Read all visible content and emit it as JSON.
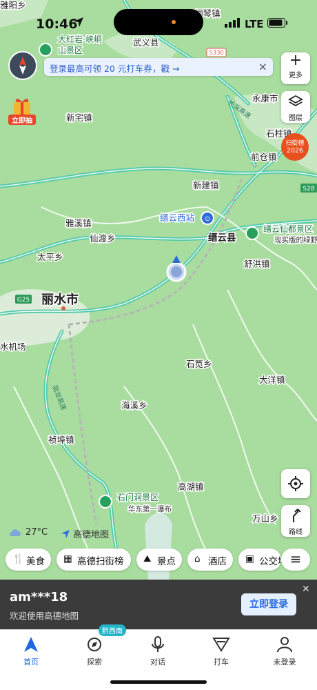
{
  "status_bar": {
    "time": "10:46",
    "network": "LTE"
  },
  "promo_banner": {
    "text": "登录最高可领 20 元打车券，戳 →"
  },
  "side_buttons": {
    "more": "更多",
    "layers": "图层",
    "route": "路线"
  },
  "gift": {
    "label": "立即抽"
  },
  "hot_badge": {
    "line1": "扫街榜",
    "line2": "2026"
  },
  "map": {
    "labels": {
      "wuyi": "武义县",
      "yongkang": "永康市",
      "shizhu": "石柱镇",
      "qiancang": "前仓镇",
      "xinzhai": "新宅镇",
      "xinjian": "新建镇",
      "yaxi": "雅溪镇",
      "xiandu": "仙渡乡",
      "jinyun_west": "缙云西站",
      "jinyun": "缙云县",
      "xianhong": "舒洪镇",
      "taiping": "太平乡",
      "lishui": "丽水市",
      "airport": "水机场",
      "shijian": "石笕乡",
      "dayang": "大洋镇",
      "haixi": "海溪乡",
      "zhenbu": "祯埠镇",
      "gaohu": "高湖镇",
      "wanshan": "万山乡",
      "top_left": "雅阳乡",
      "top_town": "桐琴镇"
    },
    "scenic": [
      {
        "name": "大红岩·峡峒",
        "name2": "山景区"
      },
      {
        "name": "缙云仙都景区",
        "sub": "现实版的绿野"
      },
      {
        "name": "石门洞景区",
        "sub": "华东第一瀑布"
      }
    ],
    "roads": {
      "g25": "G25",
      "s28": "S28",
      "s330": "S330",
      "expressway1": "长深高速",
      "expressway2": "丽龙高速"
    }
  },
  "weather": {
    "temperature": "27°C"
  },
  "brand": {
    "name": "高德地图"
  },
  "chips": [
    {
      "icon": "fork-knife-icon",
      "label": "美食"
    },
    {
      "icon": "street-icon",
      "label": "高德扫街榜"
    },
    {
      "icon": "scenic-icon",
      "label": "景点"
    },
    {
      "icon": "hotel-icon",
      "label": "酒店"
    },
    {
      "icon": "bus-icon",
      "label": "公交地铁"
    }
  ],
  "login_bar": {
    "user": "am***18",
    "subtitle": "欢迎使用高德地图",
    "button": "立即登录"
  },
  "tab_badge": "黔西南",
  "tabs": [
    {
      "label": "首页",
      "icon": "home-arrow-icon"
    },
    {
      "label": "探索",
      "icon": "explore-icon"
    },
    {
      "label": "对话",
      "icon": "mic-icon"
    },
    {
      "label": "打车",
      "icon": "taxi-icon"
    },
    {
      "label": "未登录",
      "icon": "profile-icon"
    }
  ],
  "colors": {
    "map_bg": "#a9dc9f",
    "road": "#5fd1b4",
    "accent": "#1f66e0",
    "hot": "#e8501f"
  }
}
